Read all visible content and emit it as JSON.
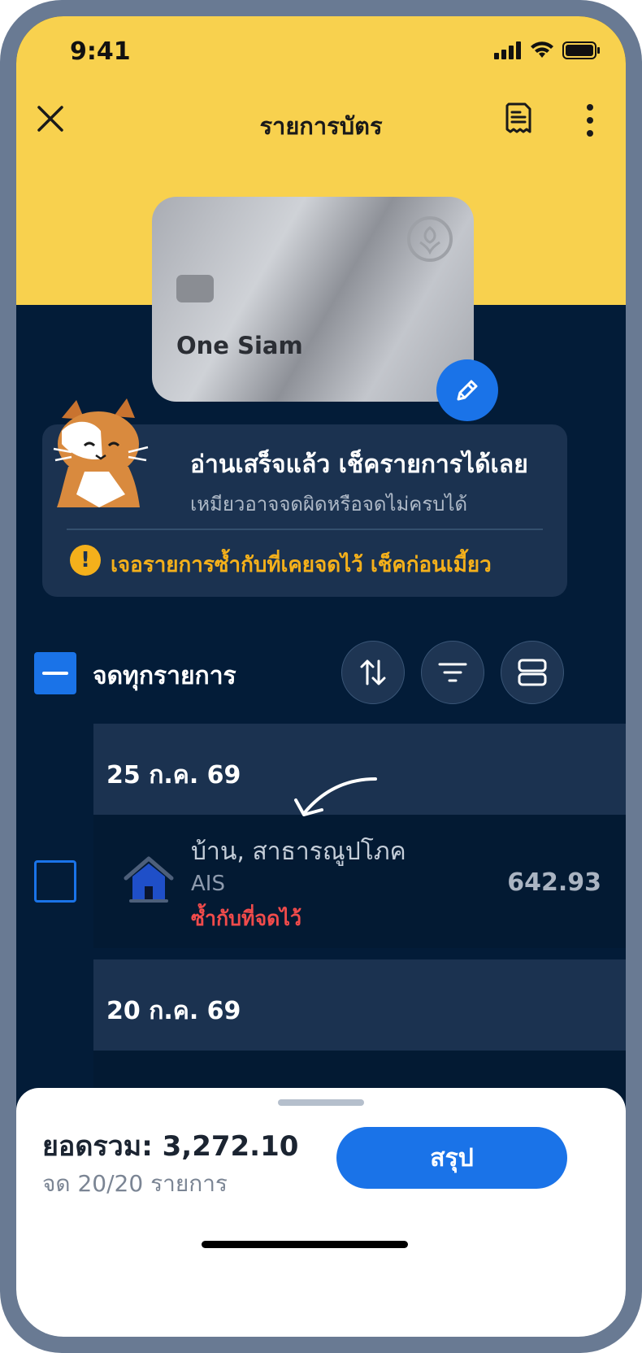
{
  "status_bar": {
    "time": "9:41"
  },
  "header": {
    "title": "รายการบัตร"
  },
  "card": {
    "name": "One Siam"
  },
  "info": {
    "title": "อ่านเสร็จแล้ว เช็ครายการได้เลย",
    "subtitle": "เหมียวอาจจดผิดหรือจดไม่ครบได้",
    "warning_icon": "!",
    "warning": "เจอรายการซ้ำกับที่เคยจดไว้ เช็คก่อนเมี้ยว"
  },
  "select_all": {
    "label": "จดทุกรายการ"
  },
  "groups": [
    {
      "date": "25 ก.ค. 69",
      "items": [
        {
          "icon": "house-icon",
          "title": "บ้าน, สาธารณูปโภค",
          "merchant": "AIS",
          "duplicate_note": "ซ้ำกับที่จดไว้",
          "amount": "642.93"
        }
      ]
    },
    {
      "date": "20 ก.ค. 69",
      "items": []
    }
  ],
  "summary": {
    "total_label": "ยอดรวม: 3,272.10",
    "count_label": "จด 20/20 รายการ",
    "button_label": "สรุป"
  },
  "colors": {
    "header_yellow": "#f8d14e",
    "background_navy": "#031c38",
    "accent_blue": "#1a73e8",
    "warning_orange": "#f4b01b",
    "duplicate_red": "#f04b4b"
  }
}
